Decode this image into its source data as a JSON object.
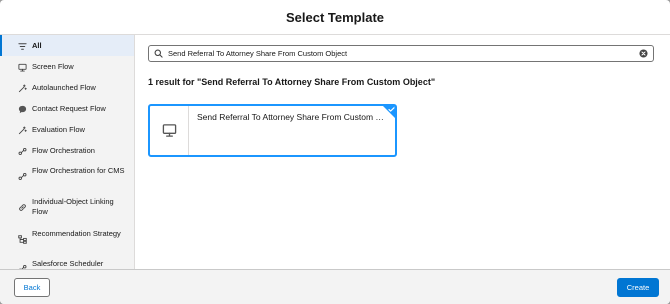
{
  "modal": {
    "title": "Select Template"
  },
  "sidebar": {
    "items": [
      {
        "label": "All",
        "icon": "flow-filter-icon"
      },
      {
        "label": "Screen Flow",
        "icon": "monitor-icon"
      },
      {
        "label": "Autolaunched Flow",
        "icon": "magic-wand-icon"
      },
      {
        "label": "Contact Request Flow",
        "icon": "chat-bubble-icon"
      },
      {
        "label": "Evaluation Flow",
        "icon": "magic-wand-icon"
      },
      {
        "label": "Flow Orchestration",
        "icon": "orchestration-icon"
      },
      {
        "label": "Flow Orchestration for CMS",
        "icon": "orchestration-icon"
      },
      {
        "label": "Individual-Object Linking Flow",
        "icon": "link-icon"
      },
      {
        "label": "Recommendation Strategy",
        "icon": "strategy-icon"
      },
      {
        "label": "Salesforce Scheduler",
        "icon": "scheduler-icon"
      }
    ]
  },
  "search": {
    "value": "Send Referral To Attorney Share From Custom Object"
  },
  "results": {
    "heading": "1 result for \"Send Referral To Attorney Share From Custom Object\"",
    "tiles": [
      {
        "label": "Send Referral To Attorney Share From Custom Object",
        "icon": "monitor-icon",
        "selected": true
      }
    ]
  },
  "footer": {
    "back_label": "Back",
    "create_label": "Create"
  },
  "colors": {
    "brand": "#0176d3",
    "selected_border": "#1b96ff",
    "sidebar_bg": "#f3f3f3",
    "active_bg": "#e5edf8"
  }
}
